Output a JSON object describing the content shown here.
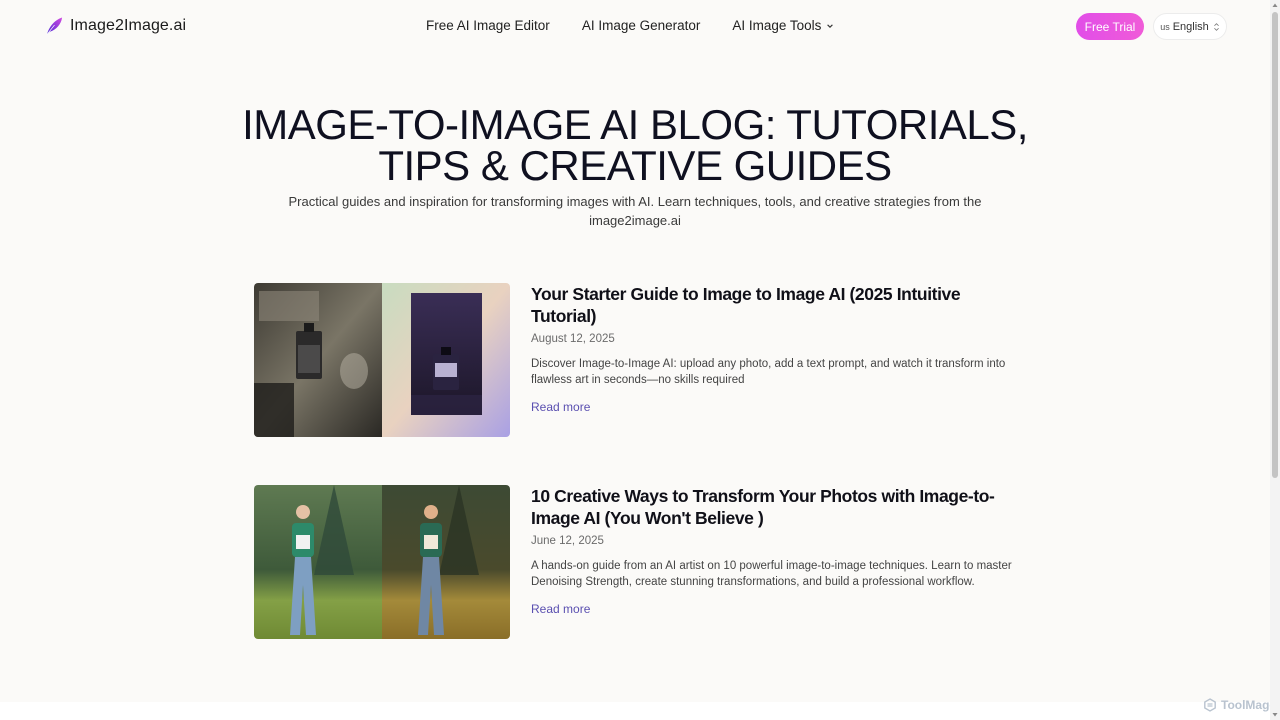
{
  "header": {
    "logo_text": "Image2Image.ai",
    "nav": [
      {
        "label": "Free AI Image Editor"
      },
      {
        "label": "AI Image Generator"
      },
      {
        "label": "AI Image Tools"
      }
    ],
    "free_trial_label": "Free Trial",
    "language": {
      "flag": "us",
      "label": "English"
    }
  },
  "hero": {
    "title_line1": "IMAGE-TO-IMAGE AI BLOG: TUTORIALS,",
    "title_line2": "TIPS & CREATIVE GUIDES",
    "subtitle": "Practical guides and inspiration for transforming images with AI. Learn techniques, tools, and creative strategies from the image2image.ai"
  },
  "posts": [
    {
      "title": "Your Starter Guide to Image to Image AI (2025 Intuitive Tutorial)",
      "date": "August 12, 2025",
      "description": "Discover Image-to-Image AI: upload any photo, add a text prompt, and watch it transform into flawless art in seconds—no skills required",
      "read_more": "Read more"
    },
    {
      "title": "10 Creative Ways to Transform Your Photos with Image-to-Image AI (You Won't Believe )",
      "date": "June 12, 2025",
      "description": "A hands-on guide from an AI artist on 10 powerful image-to-image techniques. Learn to master Denoising Strength, create stunning transformations, and build a professional workflow.",
      "read_more": "Read more"
    }
  ],
  "watermark": "ToolMage",
  "colors": {
    "accent": "#e14ee8",
    "link": "#5a4fb0",
    "background": "#fbfaf8"
  }
}
